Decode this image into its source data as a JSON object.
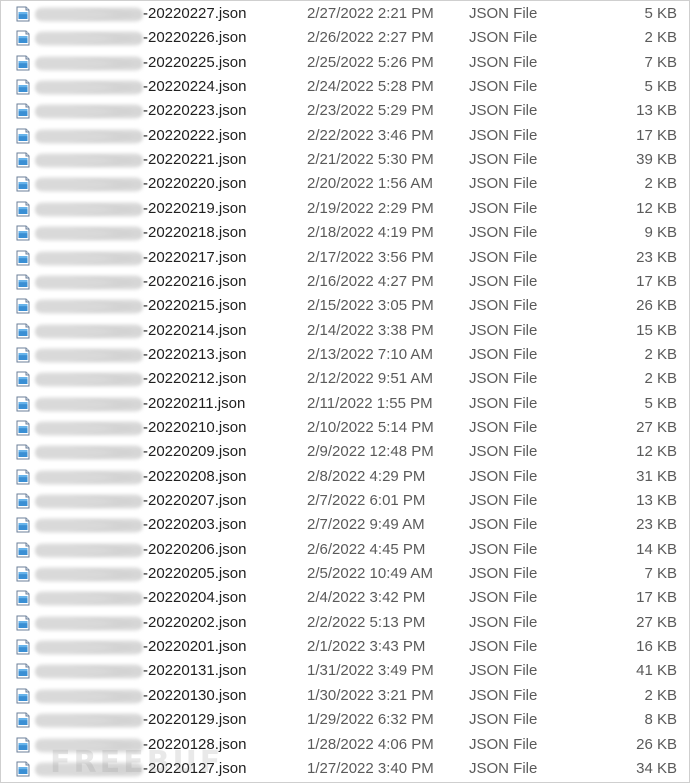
{
  "file_icon": "json-file-icon",
  "files": [
    {
      "name": "-20220227.json",
      "date": "2/27/2022 2:21 PM",
      "type": "JSON File",
      "size": "5 KB"
    },
    {
      "name": "-20220226.json",
      "date": "2/26/2022 2:27 PM",
      "type": "JSON File",
      "size": "2 KB"
    },
    {
      "name": "-20220225.json",
      "date": "2/25/2022 5:26 PM",
      "type": "JSON File",
      "size": "7 KB"
    },
    {
      "name": "-20220224.json",
      "date": "2/24/2022 5:28 PM",
      "type": "JSON File",
      "size": "5 KB"
    },
    {
      "name": "-20220223.json",
      "date": "2/23/2022 5:29 PM",
      "type": "JSON File",
      "size": "13 KB"
    },
    {
      "name": "-20220222.json",
      "date": "2/22/2022 3:46 PM",
      "type": "JSON File",
      "size": "17 KB"
    },
    {
      "name": "-20220221.json",
      "date": "2/21/2022 5:30 PM",
      "type": "JSON File",
      "size": "39 KB"
    },
    {
      "name": "-20220220.json",
      "date": "2/20/2022 1:56 AM",
      "type": "JSON File",
      "size": "2 KB"
    },
    {
      "name": "-20220219.json",
      "date": "2/19/2022 2:29 PM",
      "type": "JSON File",
      "size": "12 KB"
    },
    {
      "name": "-20220218.json",
      "date": "2/18/2022 4:19 PM",
      "type": "JSON File",
      "size": "9 KB"
    },
    {
      "name": "-20220217.json",
      "date": "2/17/2022 3:56 PM",
      "type": "JSON File",
      "size": "23 KB"
    },
    {
      "name": "-20220216.json",
      "date": "2/16/2022 4:27 PM",
      "type": "JSON File",
      "size": "17 KB"
    },
    {
      "name": "-20220215.json",
      "date": "2/15/2022 3:05 PM",
      "type": "JSON File",
      "size": "26 KB"
    },
    {
      "name": "-20220214.json",
      "date": "2/14/2022 3:38 PM",
      "type": "JSON File",
      "size": "15 KB"
    },
    {
      "name": "-20220213.json",
      "date": "2/13/2022 7:10 AM",
      "type": "JSON File",
      "size": "2 KB"
    },
    {
      "name": "-20220212.json",
      "date": "2/12/2022 9:51 AM",
      "type": "JSON File",
      "size": "2 KB"
    },
    {
      "name": "-20220211.json",
      "date": "2/11/2022 1:55 PM",
      "type": "JSON File",
      "size": "5 KB"
    },
    {
      "name": "-20220210.json",
      "date": "2/10/2022 5:14 PM",
      "type": "JSON File",
      "size": "27 KB"
    },
    {
      "name": "-20220209.json",
      "date": "2/9/2022 12:48 PM",
      "type": "JSON File",
      "size": "12 KB"
    },
    {
      "name": "-20220208.json",
      "date": "2/8/2022 4:29 PM",
      "type": "JSON File",
      "size": "31 KB"
    },
    {
      "name": "-20220207.json",
      "date": "2/7/2022 6:01 PM",
      "type": "JSON File",
      "size": "13 KB"
    },
    {
      "name": "-20220203.json",
      "date": "2/7/2022 9:49 AM",
      "type": "JSON File",
      "size": "23 KB"
    },
    {
      "name": "-20220206.json",
      "date": "2/6/2022 4:45 PM",
      "type": "JSON File",
      "size": "14 KB"
    },
    {
      "name": "-20220205.json",
      "date": "2/5/2022 10:49 AM",
      "type": "JSON File",
      "size": "7 KB"
    },
    {
      "name": "-20220204.json",
      "date": "2/4/2022 3:42 PM",
      "type": "JSON File",
      "size": "17 KB"
    },
    {
      "name": "-20220202.json",
      "date": "2/2/2022 5:13 PM",
      "type": "JSON File",
      "size": "27 KB"
    },
    {
      "name": "-20220201.json",
      "date": "2/1/2022 3:43 PM",
      "type": "JSON File",
      "size": "16 KB"
    },
    {
      "name": "-20220131.json",
      "date": "1/31/2022 3:49 PM",
      "type": "JSON File",
      "size": "41 KB"
    },
    {
      "name": "-20220130.json",
      "date": "1/30/2022 3:21 PM",
      "type": "JSON File",
      "size": "2 KB"
    },
    {
      "name": "-20220129.json",
      "date": "1/29/2022 6:32 PM",
      "type": "JSON File",
      "size": "8 KB"
    },
    {
      "name": "-20220128.json",
      "date": "1/28/2022 4:06 PM",
      "type": "JSON File",
      "size": "26 KB"
    },
    {
      "name": "-20220127.json",
      "date": "1/27/2022 3:40 PM",
      "type": "JSON File",
      "size": "34 KB"
    }
  ],
  "watermark": "FREEBUF"
}
